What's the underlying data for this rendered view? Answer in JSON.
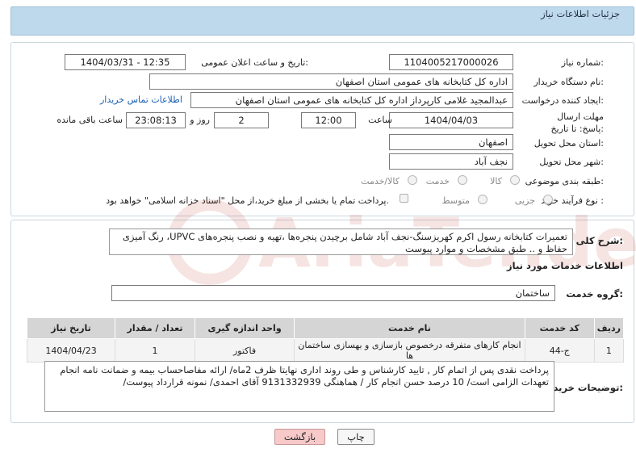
{
  "header": {
    "title": "جزئیات اطلاعات نیاز"
  },
  "fields": {
    "need_number_label": "شماره نیاز:",
    "need_number": "1104005217000026",
    "announce_label": "تاریخ و ساعت اعلان عمومی:",
    "announce_value": "1404/03/31 - 12:35",
    "buyer_org_label": "نام دستگاه خریدار:",
    "buyer_org": "اداره کل کتابخانه های عمومی استان اصفهان",
    "creator_label": "ایجاد کننده درخواست:",
    "creator": "عبدالمجید غلامی کارپرداز اداره کل کتابخانه های عمومی استان اصفهان",
    "contact_link": "اطلاعات تماس خریدار",
    "deadline_label": "مهلت ارسال پاسخ: تا تاریخ:",
    "deadline_date": "1404/04/03",
    "time_label": "ساعت",
    "deadline_time": "12:00",
    "days_value": "2",
    "days_label": "روز و",
    "remaining_time": "23:08:13",
    "remaining_label": "ساعت باقی مانده",
    "province_label": "استان محل تحویل:",
    "province": "اصفهان",
    "city_label": "شهر محل تحویل:",
    "city": "نجف آباد",
    "category_label": "طبقه بندی موضوعی:",
    "category_options": [
      "کالا",
      "خدمت",
      "کالا/خدمت"
    ],
    "process_label": "نوع فرآیند خرید :",
    "process_options": [
      "جزیی",
      "متوسط"
    ],
    "payment_note": "پرداخت تمام یا بخشی از مبلغ خرید،از محل \"اسناد خزانه اسلامی\" خواهد بود."
  },
  "description": {
    "label": "شرح کلی نیاز:",
    "text": "تعمیرات کتابخانه رسول اکرم کهریزسنگ-نجف آباد شامل برچیدن پنجره‌ها ،تهیه و نصب پنجره‌های UPVC، رنگ آمیزی حفاظ و .. طبق مشخصات و موارد پیوست"
  },
  "services": {
    "section_title": "اطلاعات خدمات مورد نیاز",
    "group_label": "گروه خدمت:",
    "group_value": "ساختمان",
    "columns": [
      "ردیف",
      "کد خدمت",
      "نام خدمت",
      "واحد اندازه گیری",
      "تعداد / مقدار",
      "تاریخ نیاز"
    ],
    "rows": [
      [
        "1",
        "ج-44",
        "انجام کارهای متفرقه درخصوص بازسازی و بهسازی ساختمان ها",
        "فاکتور",
        "1",
        "1404/04/23"
      ]
    ]
  },
  "buyer_notes": {
    "label": "توضیحات خریدار:",
    "text": "پرداخت نقدی پس از اتمام کار , تایید کارشناس و طی روند اداری نهایتا ظرف 2ماه/ ارائه مفاصاحساب بیمه و ضمانت نامه انجام تعهدات الزامی است/ 10 درصد حسن انجام کار /  هماهنگی 9131332939 آقای احمدی/ نمونه قرارداد پیوست/"
  },
  "buttons": {
    "print": "چاپ",
    "back": "بازگشت"
  },
  "watermark": {
    "text": "AriaTender.neT"
  },
  "colors": {
    "header_bg": "#bfd9ec",
    "link": "#1a5fb4",
    "back_button": "#f7c9c9",
    "watermark": "#c0392b"
  }
}
